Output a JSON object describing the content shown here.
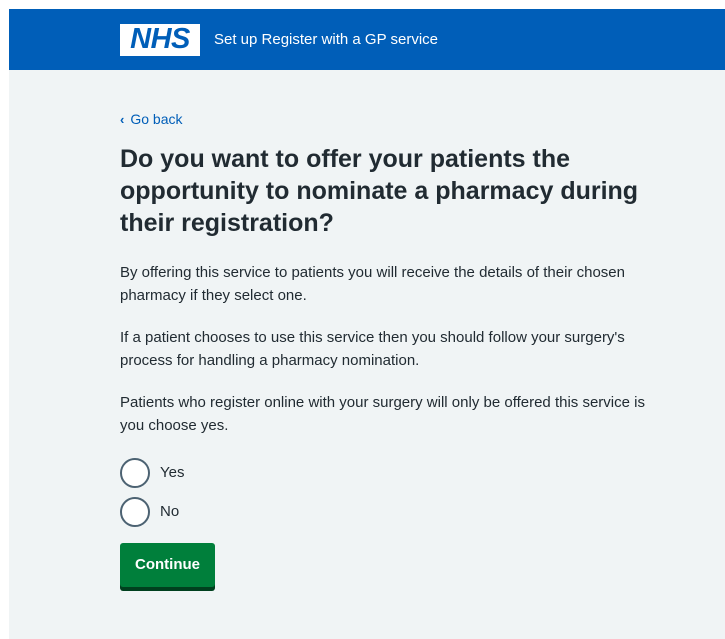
{
  "header": {
    "logo_text": "NHS",
    "service_name": "Set up Register with a GP service"
  },
  "back_link": {
    "label": "Go back"
  },
  "page": {
    "title": "Do you want to offer your patients the opportunity to nominate a pharmacy during their registration?",
    "paragraphs": [
      "By offering this service to patients you will receive the details of their chosen pharmacy if they select one.",
      "If a patient chooses to use this service then you should follow your surgery's process for handling a pharmacy nomination.",
      "Patients who register online with your surgery will only be offered this service is you choose yes."
    ]
  },
  "radios": {
    "options": [
      {
        "label": "Yes",
        "checked": false
      },
      {
        "label": "No",
        "checked": false
      }
    ]
  },
  "continue_button": {
    "label": "Continue"
  },
  "colors": {
    "header_blue": "#005eb8",
    "page_background": "#f0f4f5",
    "button_green": "#007f3b",
    "link_blue": "#005eb8",
    "text": "#212b32"
  }
}
